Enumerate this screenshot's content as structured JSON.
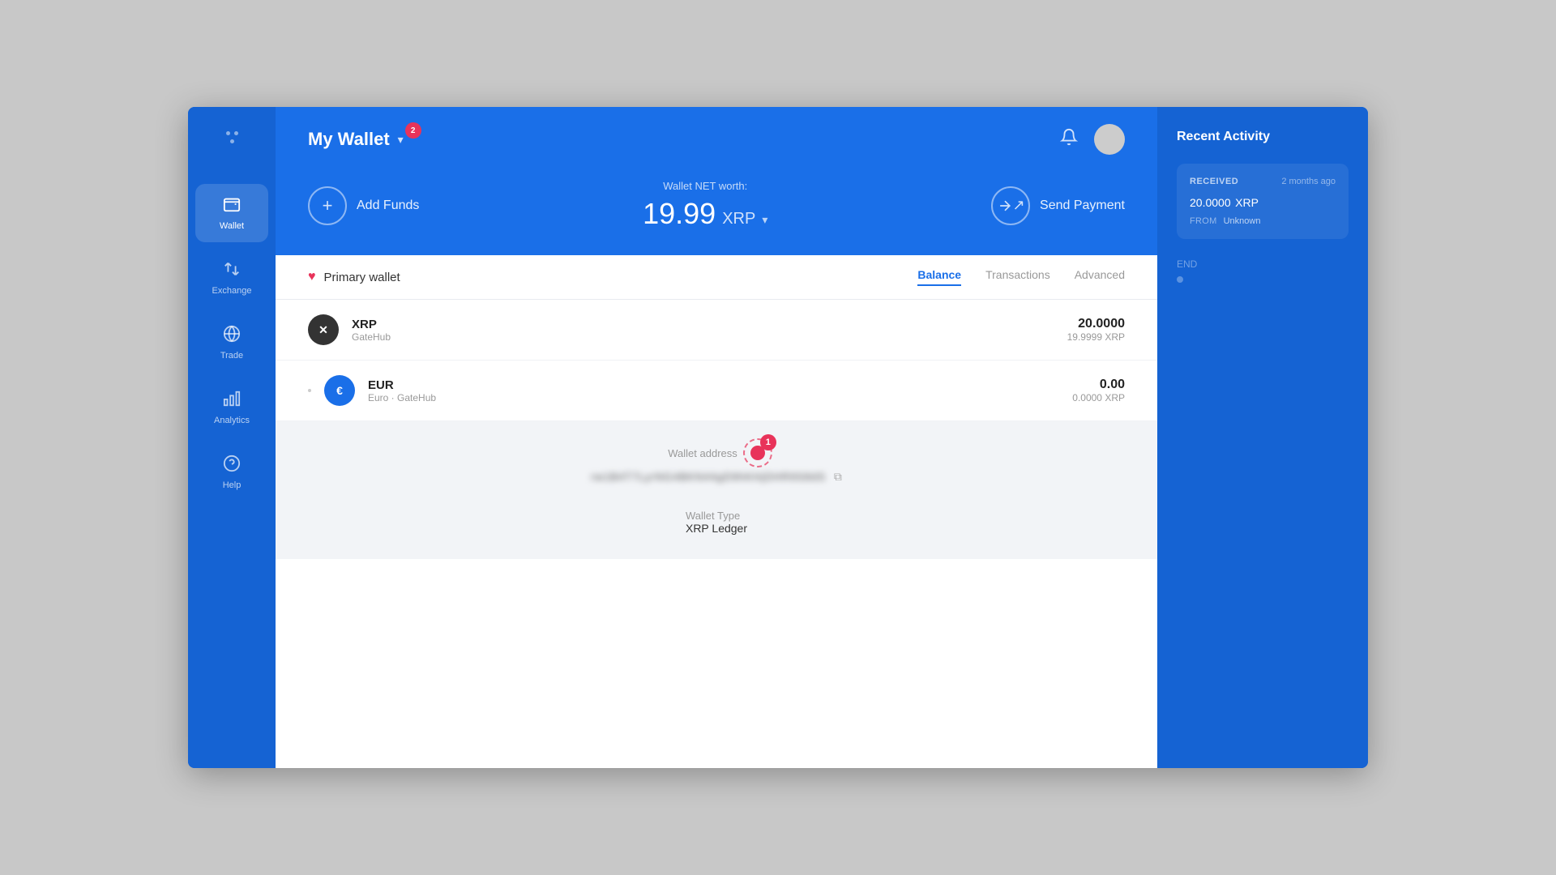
{
  "app": {
    "title": "My Wallet"
  },
  "header": {
    "title": "My Wallet",
    "badge": "2",
    "bell_icon": "🔔"
  },
  "hero": {
    "add_funds_label": "Add Funds",
    "net_worth_label": "Wallet NET worth:",
    "net_worth_value": "19.99",
    "net_worth_currency": "XRP",
    "send_payment_label": "Send Payment"
  },
  "wallet": {
    "name": "Primary wallet",
    "tabs": [
      {
        "label": "Balance",
        "active": true
      },
      {
        "label": "Transactions",
        "active": false
      },
      {
        "label": "Advanced",
        "active": false
      }
    ],
    "currencies": [
      {
        "symbol": "✕",
        "name": "XRP",
        "issuer": "GateHub",
        "balance": "20.0000",
        "balance_xrp": "19.9999 XRP",
        "type": "xrp"
      },
      {
        "symbol": "€",
        "name": "EUR",
        "issuer": "Euro · GateHub",
        "balance": "0.00",
        "balance_xrp": "0.0000 XRP",
        "type": "eur"
      }
    ],
    "address_label": "Wallet address",
    "address_value": "rw1B4T7LyrNG4BKN44gD9hKHjDHR9S8dS",
    "address_blurred": "rw1B4T7LyrNG4BKN44g••••••••••••••••••",
    "wallet_type_label": "Wallet Type",
    "wallet_type_value": "XRP Ledger"
  },
  "recent_activity": {
    "title": "Recent Activity",
    "items": [
      {
        "type": "RECEIVED",
        "time": "2 months ago",
        "amount": "20.0000",
        "currency": "XRP",
        "from_label": "FROM",
        "from_value": "Unknown"
      }
    ],
    "end_label": "END"
  },
  "sidebar": {
    "items": [
      {
        "icon": "💳",
        "label": "Wallet",
        "active": true
      },
      {
        "icon": "⇄",
        "label": "Exchange",
        "active": false
      },
      {
        "icon": "🌐",
        "label": "Trade",
        "active": false
      },
      {
        "icon": "📊",
        "label": "Analytics",
        "active": false
      },
      {
        "icon": "❓",
        "label": "Help",
        "active": false
      }
    ]
  }
}
